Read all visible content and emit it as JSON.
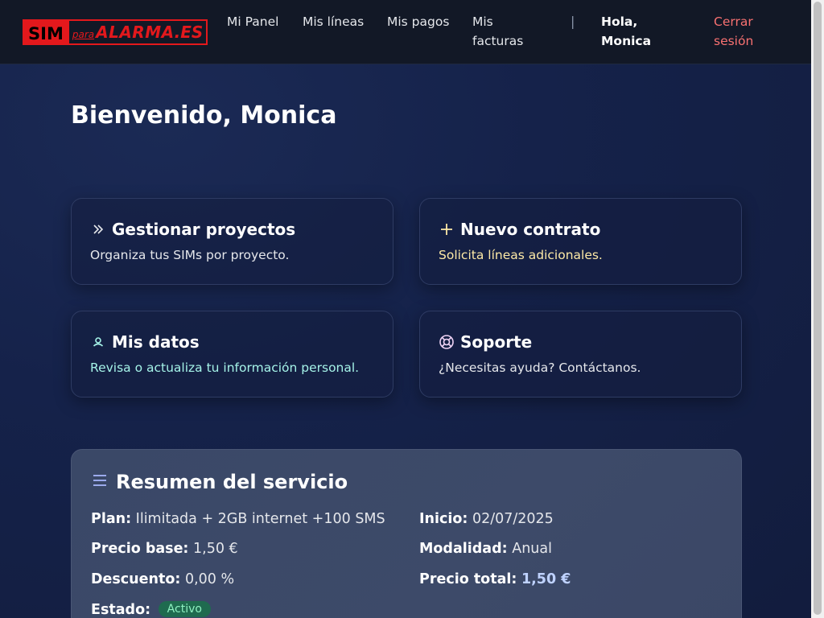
{
  "logo": {
    "sim": "SIM",
    "para": "para",
    "alarma": "ALARMA",
    "es": ".ES"
  },
  "nav": {
    "items": [
      {
        "label": "Mi Panel"
      },
      {
        "label": "Mis líneas"
      },
      {
        "label": "Mis pagos"
      },
      {
        "label": "Mis facturas"
      }
    ],
    "separator": "|",
    "greeting": "Hola, Monica",
    "logout": "Cerrar sesión"
  },
  "page": {
    "title": "Bienvenido, Monica"
  },
  "cards": [
    {
      "title": "Gestionar proyectos",
      "description": "Organiza tus SIMs por proyecto.",
      "icon": "double-chevron-right-icon",
      "color": "#e5e7eb"
    },
    {
      "title": "Nuevo contrato",
      "description": "Solicita líneas adicionales.",
      "icon": "plus-icon",
      "color": "#fde9a6"
    },
    {
      "title": "Mis datos",
      "description": "Revisa o actualiza tu información personal.",
      "icon": "user-icon",
      "color": "#a5f3e8"
    },
    {
      "title": "Soporte",
      "description": "¿Necesitas ayuda? Contáctanos.",
      "icon": "lifebuoy-icon",
      "color": "#e5e7eb"
    }
  ],
  "summary": {
    "title": "Resumen del servicio",
    "icon": "menu-lines-icon",
    "plan_label": "Plan:",
    "plan_value": "Ilimitada + 2GB internet +100 SMS",
    "start_label": "Inicio:",
    "start_value": "02/07/2025",
    "base_label": "Precio base:",
    "base_value": "1,50 €",
    "mode_label": "Modalidad:",
    "mode_value": "Anual",
    "discount_label": "Descuento:",
    "discount_value": "0,00 %",
    "total_label": "Precio total:",
    "total_value": "1,50 €",
    "status_label": "Estado:",
    "status_value": "Activo"
  },
  "colors": {
    "accent_red": "#e3181c",
    "logout": "#f87171",
    "status_green": "#1f6b4f"
  }
}
